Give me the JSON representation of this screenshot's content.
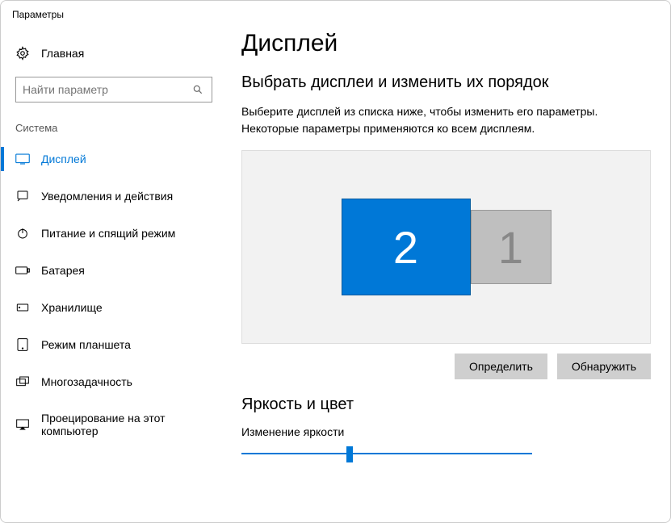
{
  "window_title": "Параметры",
  "sidebar": {
    "home_label": "Главная",
    "search_placeholder": "Найти параметр",
    "group_label": "Система",
    "items": [
      {
        "label": "Дисплей"
      },
      {
        "label": "Уведомления и действия"
      },
      {
        "label": "Питание и спящий режим"
      },
      {
        "label": "Батарея"
      },
      {
        "label": "Хранилище"
      },
      {
        "label": "Режим планшета"
      },
      {
        "label": "Многозадачность"
      },
      {
        "label": "Проецирование на этот компьютер"
      }
    ]
  },
  "main": {
    "page_title": "Дисплей",
    "section1_title": "Выбрать дисплеи и изменить их порядок",
    "section1_desc": "Выберите дисплей из списка ниже, чтобы изменить его параметры. Некоторые параметры применяются ко всем дисплеям.",
    "displays": [
      {
        "id": "2",
        "selected": true
      },
      {
        "id": "1",
        "selected": false
      }
    ],
    "identify_label": "Определить",
    "detect_label": "Обнаружить",
    "section2_title": "Яркость и цвет",
    "brightness_label": "Изменение яркости"
  }
}
